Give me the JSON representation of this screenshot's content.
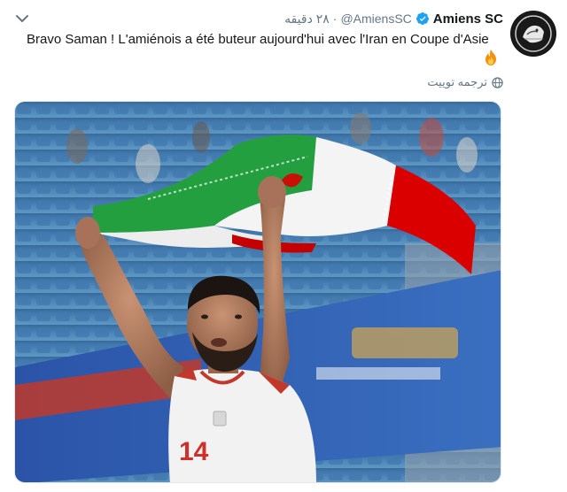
{
  "tweet": {
    "display_name": "Amiens SC",
    "handle": "@AmiensSC",
    "separator": "·",
    "timestamp": "۲۸ دقیقه",
    "text_line1": "Bravo Saman ! L'amiénois a été buteur aujourd'hui avec l'Iran en Coupe d'Asie",
    "translate_label": "ترجمه توییت",
    "jersey_number": "14",
    "verified": true
  },
  "icons": {
    "menu": "chevron-down-icon",
    "verified": "verified-badge-icon",
    "emoji": "fire-emoji-icon",
    "translate": "globe-icon"
  },
  "colors": {
    "text": "#14171a",
    "secondary": "#657786",
    "verified_blue": "#1da1f2",
    "flag_green": "#239f40",
    "flag_red": "#da0000"
  }
}
